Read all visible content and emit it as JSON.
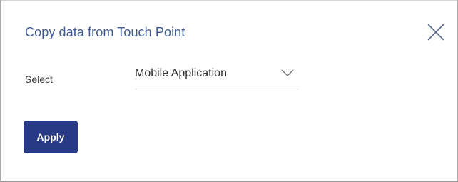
{
  "dialog": {
    "title": "Copy data from Touch Point",
    "close_icon": "close-icon"
  },
  "form": {
    "select_label": "Select",
    "select_value": "Mobile Application",
    "dropdown_icon": "chevron-down-icon"
  },
  "actions": {
    "apply_label": "Apply"
  },
  "colors": {
    "title": "#3e5a94",
    "primary_button": "#283a86",
    "icon": "#5a6a8a"
  }
}
